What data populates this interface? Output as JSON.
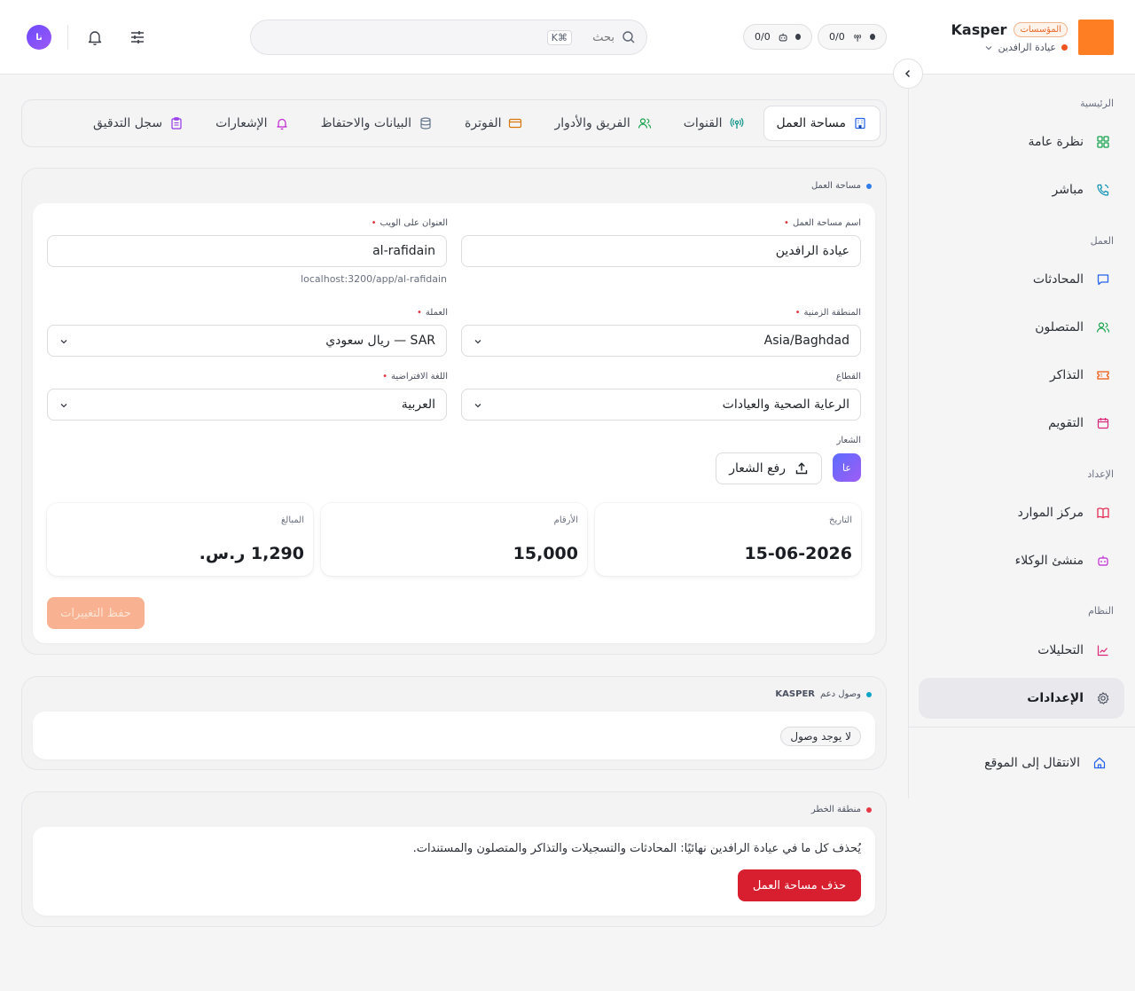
{
  "brand": {
    "name": "Kasper",
    "badge": "المؤسسات",
    "workspace": "عيادة الرافدين"
  },
  "header": {
    "pill_channels": "0/0",
    "pill_agents": "0/0",
    "search_placeholder": "بحث",
    "search_shortcut": "⌘K",
    "avatar_initials": "نا"
  },
  "sidebar": {
    "sections": {
      "home": "الرئيسية",
      "work": "العمل",
      "setup": "الإعداد",
      "system": "النظام"
    },
    "items": [
      {
        "label": "نظرة عامة",
        "icon": "grid-icon",
        "color": "#16a34a"
      },
      {
        "label": "مباشر",
        "icon": "phone-icon",
        "color": "#0891b2"
      },
      {
        "label": "المحادثات",
        "icon": "chat-icon",
        "color": "#2563eb"
      },
      {
        "label": "المتصلون",
        "icon": "users-icon",
        "color": "#16a34a"
      },
      {
        "label": "التذاكر",
        "icon": "ticket-icon",
        "color": "#ea580c"
      },
      {
        "label": "التقويم",
        "icon": "calendar-icon",
        "color": "#db2777"
      },
      {
        "label": "مركز الموارد",
        "icon": "book-icon",
        "color": "#e11d48"
      },
      {
        "label": "منشئ الوكلاء",
        "icon": "robot-icon",
        "color": "#c026d3"
      },
      {
        "label": "التحليلات",
        "icon": "chart-icon",
        "color": "#db2777"
      },
      {
        "label": "الإعدادات",
        "icon": "gear-icon",
        "color": "#4b5160"
      }
    ],
    "footer_link": "الانتقال إلى الموقع"
  },
  "tabs": [
    {
      "label": "مساحة العمل",
      "icon": "building-icon",
      "color": "#2563eb"
    },
    {
      "label": "القنوات",
      "icon": "antenna-icon",
      "color": "#0d9488"
    },
    {
      "label": "الفريق والأدوار",
      "icon": "users-icon",
      "color": "#16a34a"
    },
    {
      "label": "الفوترة",
      "icon": "card-icon",
      "color": "#d97706"
    },
    {
      "label": "البيانات والاحتفاظ",
      "icon": "database-icon",
      "color": "#64748b"
    },
    {
      "label": "الإشعارات",
      "icon": "bell-icon",
      "color": "#c026d3"
    },
    {
      "label": "سجل التدقيق",
      "icon": "clipboard-icon",
      "color": "#9333ea"
    }
  ],
  "workspace_card": {
    "title": "مساحة العمل",
    "name_label": "اسم مساحة العمل",
    "name_value": "عيادة الرافدين",
    "url_label": "العنوان على الويب",
    "url_value": "al-rafidain",
    "url_hint": "localhost:3200/app/al-rafidain",
    "timezone_label": "المنطقة الزمنية",
    "timezone_value": "Asia/Baghdad",
    "currency_label": "العملة",
    "currency_value": "SAR — ريال سعودي",
    "sector_label": "القطاع",
    "sector_value": "الرعاية الصحية والعيادات",
    "language_label": "اللغة الافتراضية",
    "language_value": "العربية",
    "logo_label": "الشعار",
    "logo_initials": "عا",
    "upload_label": "رفع الشعار",
    "stats": [
      {
        "label": "التاريخ",
        "value": "15-06-2026"
      },
      {
        "label": "الأرقام",
        "value": "15,000"
      },
      {
        "label": "المبالغ",
        "value": "1,290 ر.س."
      }
    ],
    "save_label": "حفظ التغييرات"
  },
  "support_card": {
    "title_prefix": "وصول دعم",
    "title_brand": "KASPER",
    "status": "لا يوجد وصول"
  },
  "danger_card": {
    "title": "منطقة الخطر",
    "warning": "يُحذف كل ما في عيادة الرافدين نهائيًا: المحادثات والتسجيلات والتذاكر والمتصلون والمستندات.",
    "delete_label": "حذف مساحة العمل"
  },
  "colors": {
    "accent": "#fd7e23",
    "danger": "#d81f2f",
    "blue_dot": "#2f7be8",
    "cyan_dot": "#0ea5c6",
    "red_dot": "#e53945"
  }
}
